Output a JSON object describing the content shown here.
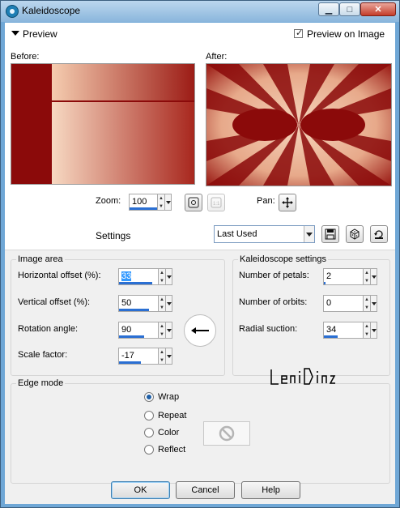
{
  "window": {
    "title": "Kaleidoscope",
    "controls": {
      "minimize": "▁",
      "maximize": "□",
      "close": "✕"
    }
  },
  "preview": {
    "section_label": "Preview",
    "preview_on_image_label": "Preview on Image",
    "preview_on_image_checked": true,
    "before_label": "Before:",
    "after_label": "After:",
    "zoom_label": "Zoom:",
    "zoom_value": "100",
    "pan_label": "Pan:"
  },
  "settings": {
    "label": "Settings",
    "preset_value": "Last Used",
    "icons": [
      "save-preset-icon",
      "randomize-dice-icon",
      "reset-icon"
    ]
  },
  "image_area": {
    "title": "Image area",
    "fields": [
      {
        "label": "Horizontal offset (%):",
        "value": "33",
        "selected": true,
        "level": 0.83
      },
      {
        "label": "Vertical offset (%):",
        "value": "50",
        "selected": false,
        "level": 0.75
      },
      {
        "label": "Rotation angle:",
        "value": "90",
        "selected": false,
        "level": 0.62
      },
      {
        "label": "Scale factor:",
        "value": "-17",
        "selected": false,
        "level": 0.42
      }
    ]
  },
  "kaleidoscope_settings": {
    "title": "Kaleidoscope settings",
    "fields": [
      {
        "label": "Number of petals:",
        "value": "2",
        "level": 0.0
      },
      {
        "label": "Number of orbits:",
        "value": "0",
        "level": 0.0
      },
      {
        "label": "Radial suction:",
        "value": "34",
        "level": 0.34
      }
    ]
  },
  "edge_mode": {
    "title": "Edge mode",
    "options": [
      {
        "label": "Wrap",
        "selected": true
      },
      {
        "label": "Repeat",
        "selected": false
      },
      {
        "label": "Color",
        "selected": false
      },
      {
        "label": "Reflect",
        "selected": false
      }
    ]
  },
  "watermark": "LeniDiniz",
  "buttons": {
    "ok": "OK",
    "cancel": "Cancel",
    "help": "Help"
  },
  "colors": {
    "dark_red": "#8b0a0a",
    "peach": "#f2cfb5",
    "accent_blue": "#2a6fd3"
  }
}
